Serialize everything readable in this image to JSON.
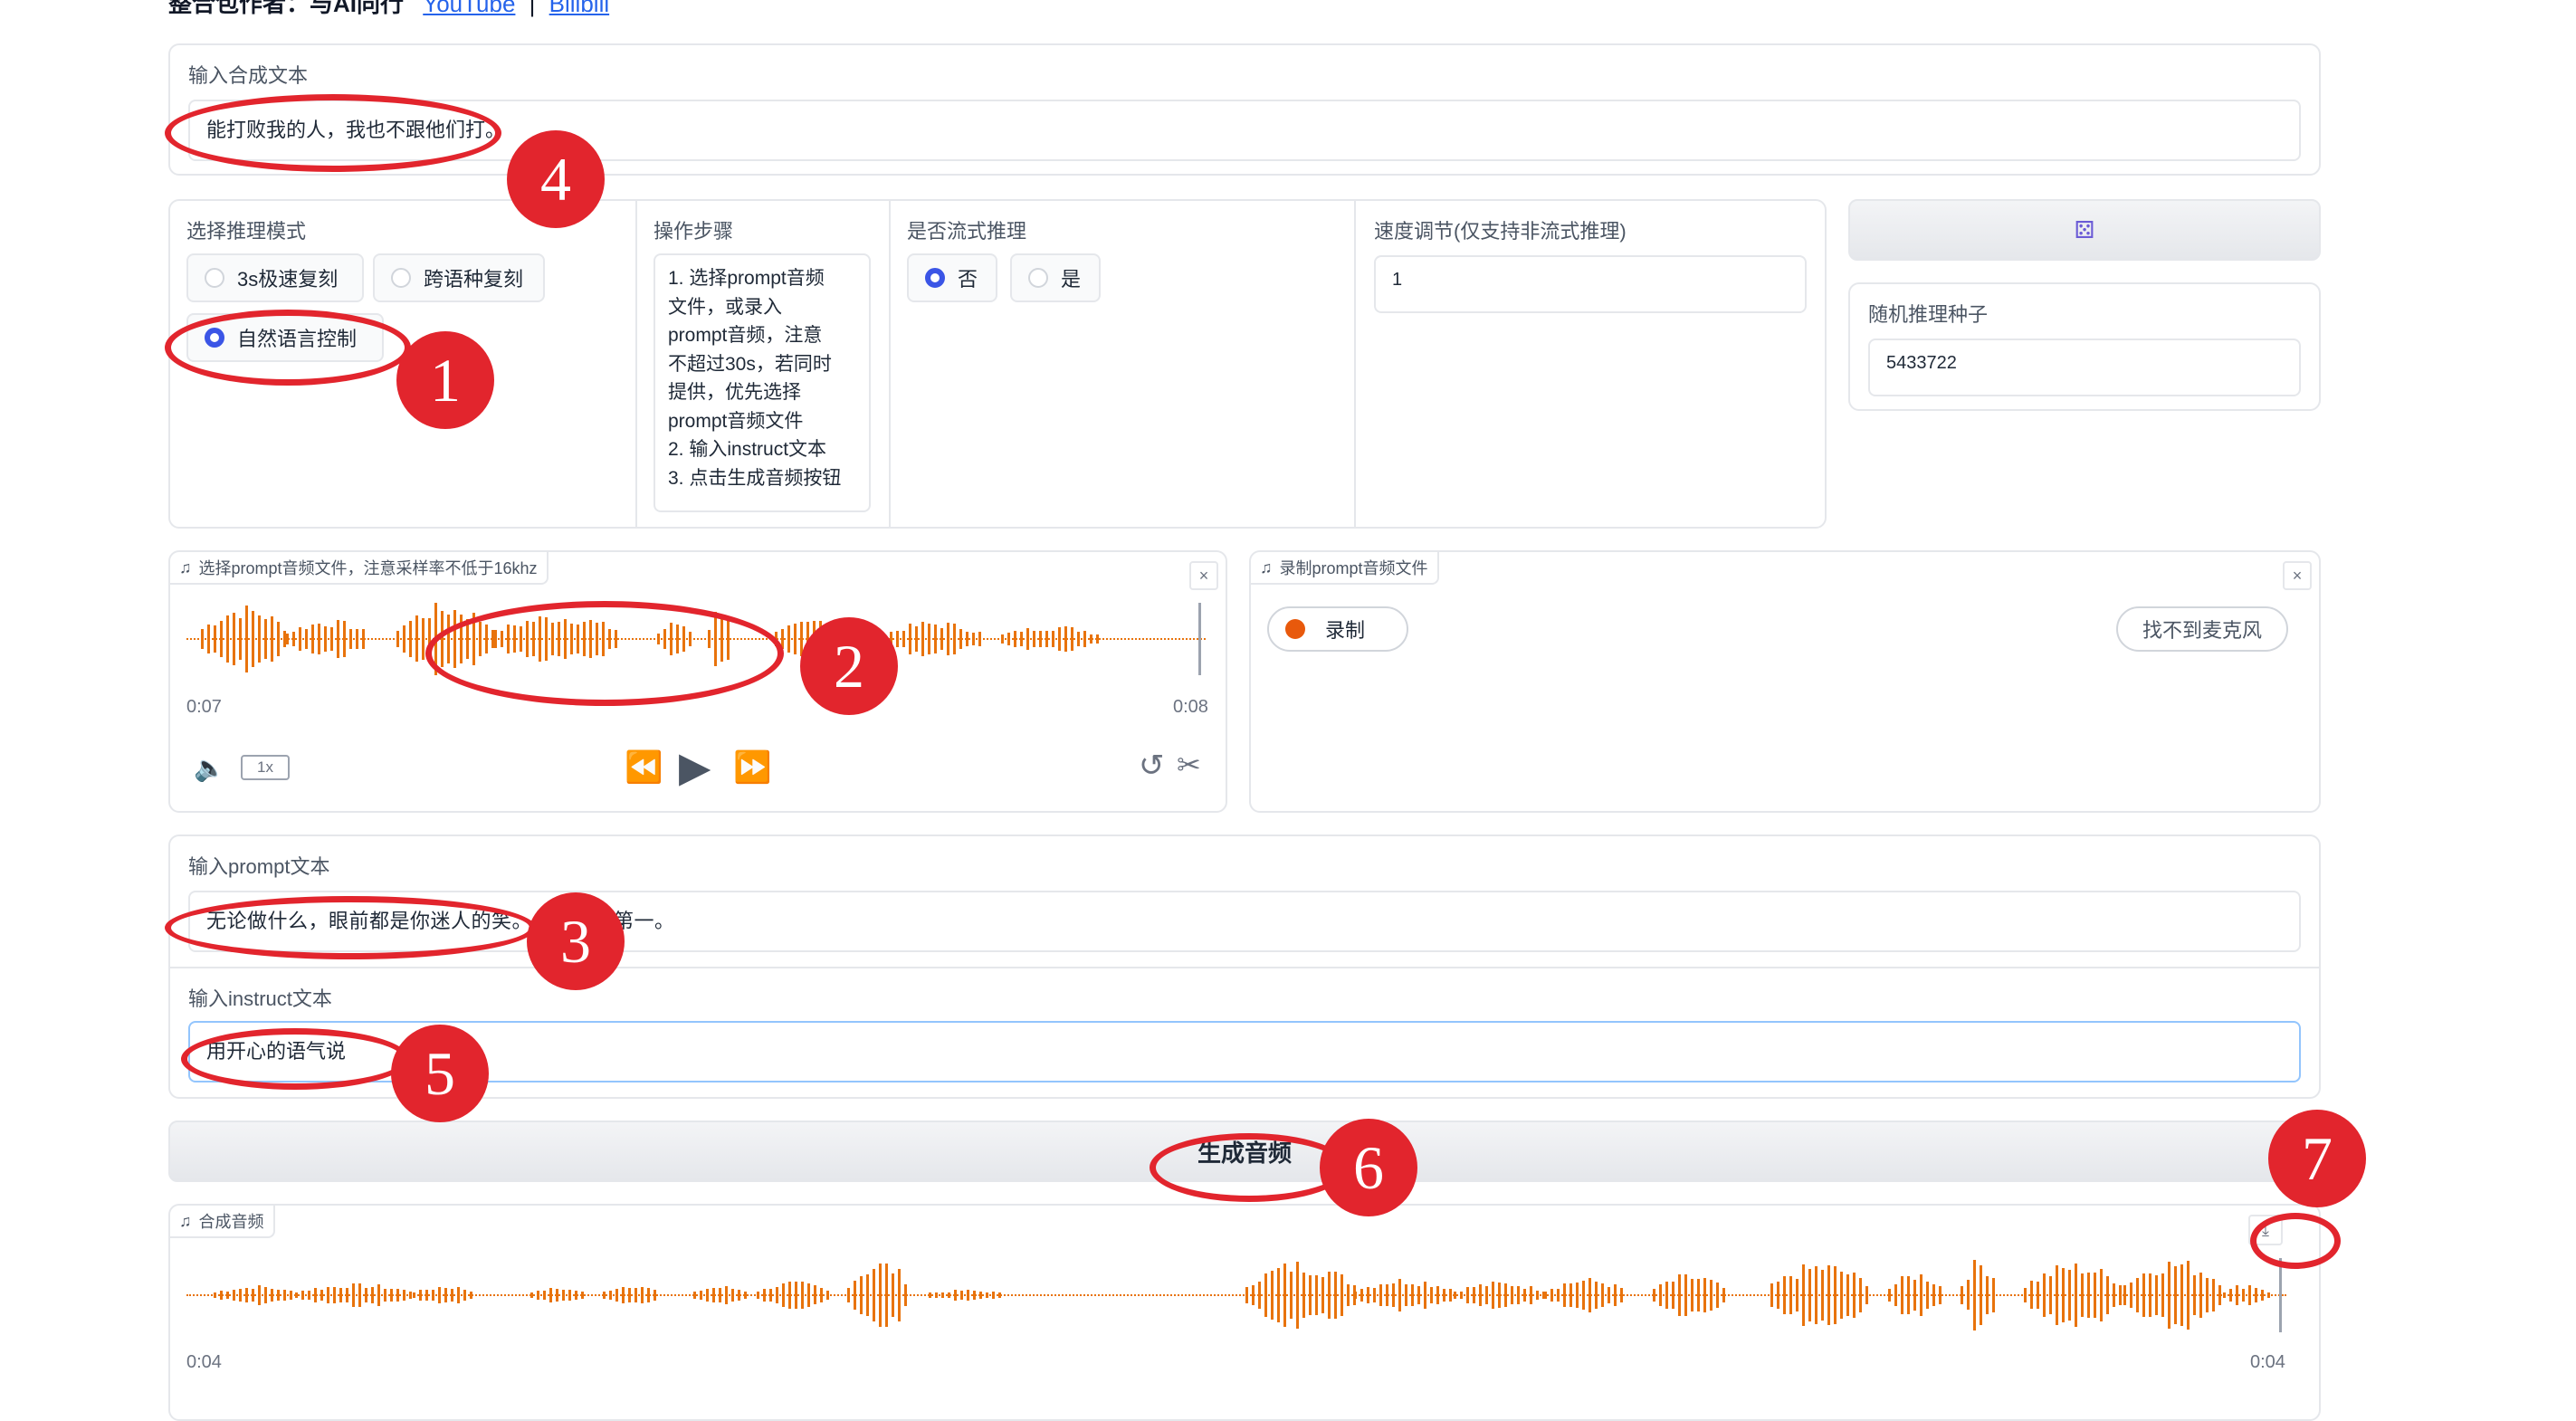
{
  "header": {
    "prefix": "整合包作者：与AI同行",
    "link1": "YouTube",
    "separator": "|",
    "link2": "Bilibili"
  },
  "tts_text": {
    "label": "输入合成文本",
    "value": "能打败我的人，我也不跟他们打。"
  },
  "mode": {
    "label": "选择推理模式",
    "options": [
      "3s极速复刻",
      "跨语种复刻",
      "自然语言控制"
    ],
    "selected": "自然语言控制"
  },
  "steps": {
    "label": "操作步骤",
    "lines": [
      "1. 选择prompt音频",
      "文件，或录入",
      "prompt音频，注意",
      "不超过30s，若同时",
      "提供，优先选择",
      "prompt音频文件",
      "2. 输入instruct文本",
      "3. 点击生成音频按钮"
    ]
  },
  "stream": {
    "label": "是否流式推理",
    "options": [
      "否",
      "是"
    ],
    "selected": "否"
  },
  "speed": {
    "label": "速度调节(仅支持非流式推理)",
    "value": "1"
  },
  "seed": {
    "dice_icon": "dice-icon",
    "label": "随机推理种子",
    "value": "5433722"
  },
  "prompt_audio": {
    "label": "选择prompt音频文件，注意采样率不低于16khz",
    "time_start": "0:07",
    "time_end": "0:08",
    "speed": "1x",
    "icons": [
      "music-note-icon",
      "close-icon",
      "volume-icon",
      "rewind-icon",
      "play-icon",
      "fast-forward-icon",
      "undo-icon",
      "scissors-icon"
    ]
  },
  "record": {
    "label": "录制prompt音频文件",
    "record_button": "录制",
    "no_mic": "找不到麦克风"
  },
  "prompt_text": {
    "label": "输入prompt文本",
    "value": "无论做什么，眼前都是你迷人的笑。你永远排第一。"
  },
  "instruct": {
    "label": "输入instruct文本",
    "value": "用开心的语气说"
  },
  "generate": {
    "label": "生成音频"
  },
  "output_audio": {
    "label": "合成音频",
    "time_start": "0:04",
    "time_end": "0:04"
  },
  "annotations": [
    "1",
    "2",
    "3",
    "4",
    "5",
    "6",
    "7"
  ],
  "colors": {
    "annotation": "#e2252d",
    "waveform": "#e8730c",
    "radio_selected": "#3b55e6",
    "record_dot": "#e8590c"
  }
}
